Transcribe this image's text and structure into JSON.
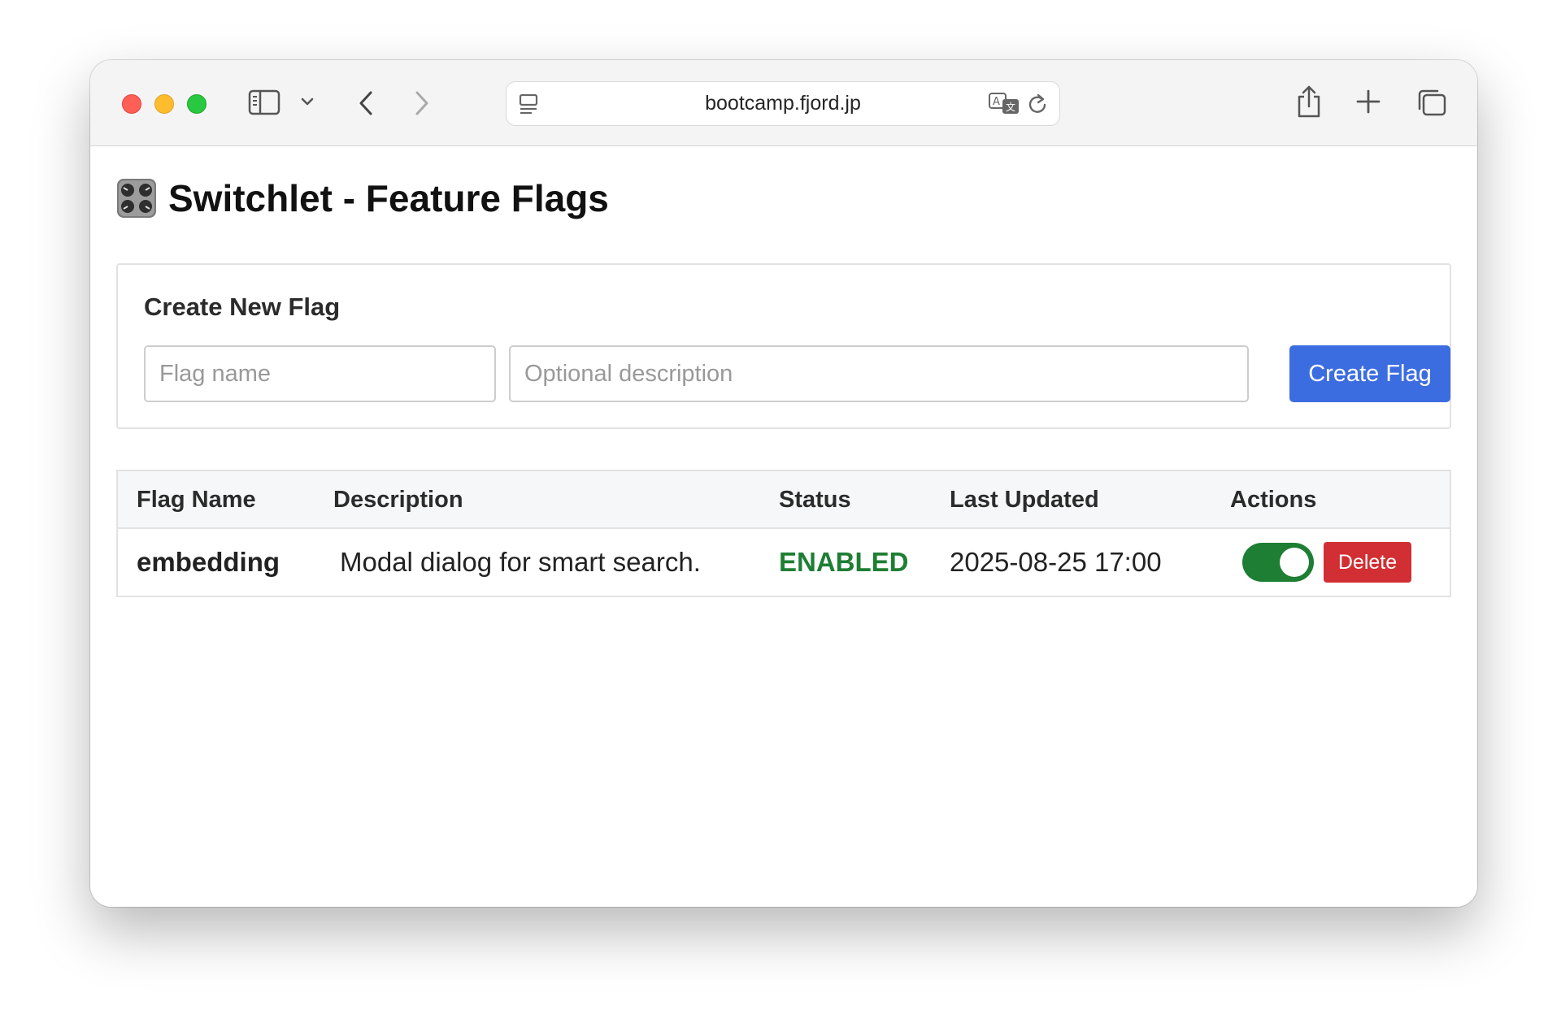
{
  "browser": {
    "url": "bootcamp.fjord.jp"
  },
  "page": {
    "title": "Switchlet - Feature Flags",
    "title_icon": "control-knobs-icon"
  },
  "create_form": {
    "heading": "Create New Flag",
    "name_placeholder": "Flag name",
    "name_value": "",
    "description_placeholder": "Optional description",
    "description_value": "",
    "submit_label": "Create Flag",
    "submit_color": "#3c6de0"
  },
  "flags_table": {
    "columns": [
      "Flag Name",
      "Description",
      "Status",
      "Last Updated",
      "Actions"
    ],
    "rows": [
      {
        "name": "embedding",
        "description": "Modal dialog for smart search.",
        "status": "ENABLED",
        "status_color": "#1e7e34",
        "last_updated": "2025-08-25 17:00",
        "toggle_on": true,
        "delete_label": "Delete",
        "delete_color": "#d12f33"
      }
    ]
  }
}
